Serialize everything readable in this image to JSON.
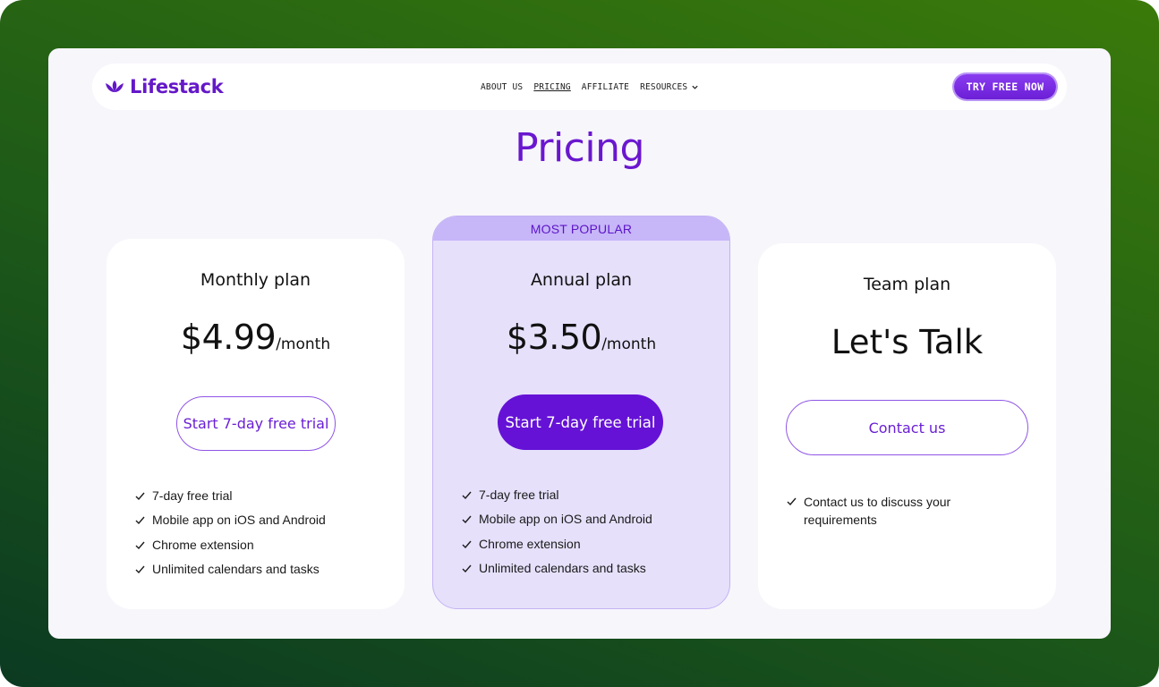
{
  "brand": {
    "name": "Lifestack",
    "color": "#6418c8"
  },
  "nav": {
    "links": [
      {
        "label": "ABOUT US",
        "active": false
      },
      {
        "label": "PRICING",
        "active": true
      },
      {
        "label": "AFFILIATE",
        "active": false
      },
      {
        "label": "RESOURCES",
        "active": false,
        "dropdown": true
      }
    ],
    "cta_label": "TRY FREE NOW"
  },
  "page": {
    "title": "Pricing"
  },
  "plans": [
    {
      "name": "Monthly plan",
      "price": "$4.99",
      "period": "/month",
      "button": "Start 7-day free trial",
      "features": [
        "7-day free trial",
        "Mobile app on iOS and Android",
        "Chrome extension",
        "Unlimited calendars and tasks"
      ]
    },
    {
      "badge": "MOST POPULAR",
      "name": "Annual plan",
      "price": "$3.50",
      "period": "/month",
      "button": "Start 7-day free trial",
      "features": [
        "7-day free trial",
        "Mobile app on iOS and Android",
        "Chrome extension",
        "Unlimited calendars and tasks"
      ]
    },
    {
      "name": "Team plan",
      "price_text": "Let's Talk",
      "button": "Contact us",
      "features": [
        "Contact us to discuss your requirements"
      ]
    }
  ],
  "colors": {
    "accent": "#6512d6",
    "highlight_card": "#e6e0fb",
    "badge": "#c7b6f8",
    "background_gradient": [
      "#0b3a22",
      "#3a7a0a"
    ]
  },
  "icons": {
    "logo": "lotus-icon",
    "dropdown": "chevron-down-icon",
    "feature": "check-icon"
  }
}
